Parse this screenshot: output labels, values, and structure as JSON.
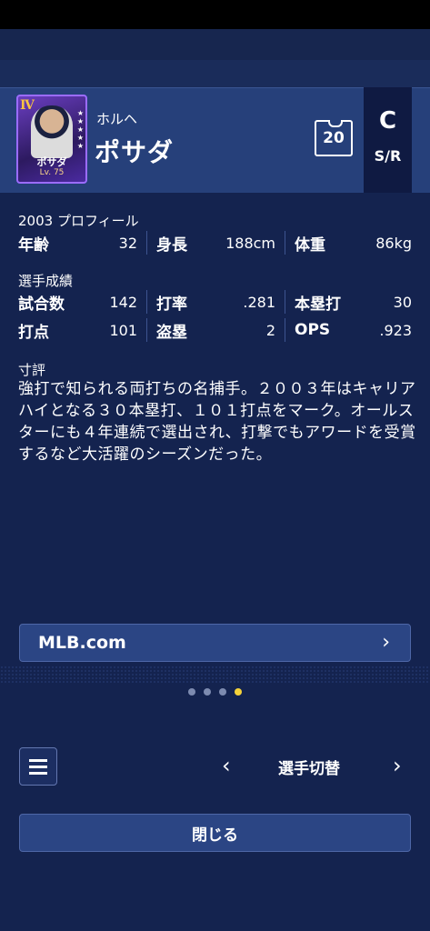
{
  "card": {
    "grade": "Ⅳ",
    "name": "ポサダ",
    "level": "Lv. 75"
  },
  "header": {
    "team": "ホルヘ",
    "player_name": "ポサダ",
    "uniform_number": "20",
    "position": "C",
    "bats_throws": "S/R"
  },
  "profile": {
    "section_title": "2003 プロフィール",
    "stats": [
      {
        "label": "年齢",
        "value": "32"
      },
      {
        "label": "身長",
        "value": "188cm"
      },
      {
        "label": "体重",
        "value": "86kg"
      }
    ]
  },
  "record": {
    "section_title": "選手成績",
    "rows": [
      [
        {
          "label": "試合数",
          "value": "142"
        },
        {
          "label": "打率",
          "value": ".281"
        },
        {
          "label": "本塁打",
          "value": "30"
        }
      ],
      [
        {
          "label": "打点",
          "value": "101"
        },
        {
          "label": "盗塁",
          "value": "2"
        },
        {
          "label": "OPS",
          "value": ".923"
        }
      ]
    ]
  },
  "review": {
    "section_title": "寸評",
    "text": "強打で知られる両打ちの名捕手。２００３年はキャリアハイとなる３０本塁打、１０１打点をマーク。オールスターにも４年連続で選出され、打撃でもアワードを受賞するなど大活躍のシーズンだった。"
  },
  "link": {
    "label": "MLB.com"
  },
  "pagination": {
    "total": 4,
    "active_index": 3
  },
  "footer": {
    "switch_label": "選手切替",
    "close_label": "閉じる"
  },
  "colors": {
    "background": "#14234f",
    "header": "#26407a",
    "accent_dot": "#f5d23a",
    "button": "#2b4584"
  }
}
